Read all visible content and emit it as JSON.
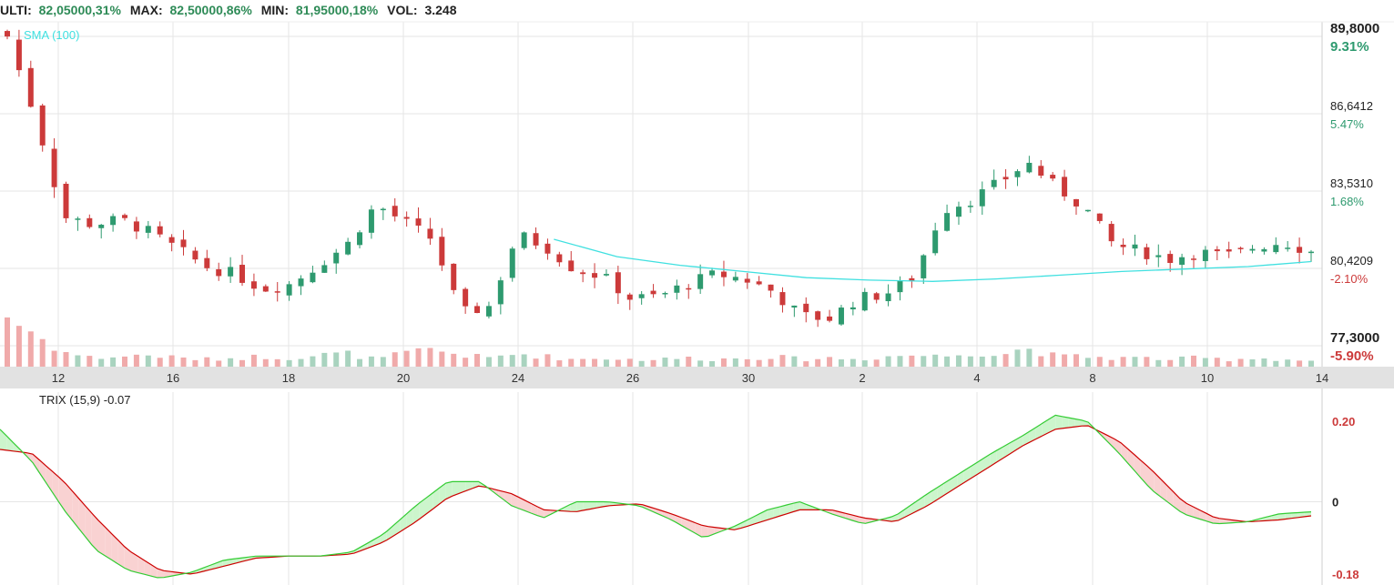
{
  "header": {
    "ulti_label": "ULTI:",
    "ulti_value": "82,05000,31%",
    "max_label": "MAX:",
    "max_value": "82,50000,86%",
    "min_label": "MIN:",
    "min_value": "81,95000,18%",
    "vol_label": "VOL:",
    "vol_value": "3.248"
  },
  "colors": {
    "up": "#2e9a6f",
    "down": "#cc3a3a",
    "sma": "#40e0e0",
    "trix": "#33cc33",
    "trix_signal": "#cc0000",
    "grid": "#e6e6e6",
    "axis_band": "#e2e2e2"
  },
  "chart_data": [
    {
      "type": "candlestick",
      "x_ticks": [
        "12",
        "16",
        "18",
        "20",
        "24",
        "26",
        "30",
        "2",
        "4",
        "8",
        "10",
        "14"
      ],
      "y_ticks": [
        {
          "price": "89,8000",
          "pct": "9.31%",
          "bold": true
        },
        {
          "price": "86,6412",
          "pct": "5.47%",
          "bold": false
        },
        {
          "price": "83,5310",
          "pct": "1.68%",
          "bold": false
        },
        {
          "price": "80,4209",
          "pct": "-2.10%",
          "bold": false
        },
        {
          "price": "77,3000",
          "pct": "-5.90%",
          "bold": true
        }
      ],
      "ylim": [
        77.3,
        89.8
      ],
      "indicator_label": "SMA (100)",
      "ohlc_anchor_closes": [
        89.8,
        86.5,
        82.5,
        82.2,
        82.4,
        81.9,
        81.2,
        80.5,
        80.2,
        79.6,
        79.8,
        80.6,
        81.4,
        83.0,
        82.3,
        81.6,
        78.6,
        78.9,
        81.8,
        81.3,
        80.4,
        80.1,
        79.2,
        79.3,
        79.8,
        80.2,
        80.0,
        79.5,
        78.5,
        78.4,
        79.2,
        79.4,
        80.1,
        82.8,
        83.2,
        83.9,
        84.7,
        83.7,
        82.9,
        81.4,
        81.1,
        80.8,
        81.1,
        80.9,
        81.3,
        81.5,
        81.1
      ],
      "volume_anchor": [
        3.5,
        2.2,
        1.0,
        0.6,
        0.7,
        0.8,
        0.6,
        0.5,
        0.6,
        0.7,
        0.6,
        0.8,
        0.9,
        0.5,
        0.9,
        1.2,
        0.8,
        0.6,
        0.9,
        0.7,
        0.5,
        0.6,
        0.5,
        0.5,
        0.6,
        0.5,
        0.6,
        0.7,
        0.5,
        0.6,
        0.5,
        0.7,
        0.8,
        0.7,
        1.0,
        0.8,
        1.3,
        0.7,
        0.7,
        0.6,
        0.6,
        0.5,
        0.6,
        0.5,
        0.6,
        0.5,
        0.4
      ],
      "sma_start_index": 18,
      "sma_points": [
        81.6,
        80.9,
        80.55,
        80.3,
        80.05,
        79.95,
        79.9,
        80.0,
        80.15,
        80.3,
        80.4,
        80.5,
        80.7
      ]
    },
    {
      "type": "line",
      "indicator_label": "TRIX (15,9) -0.07",
      "y_ticks": [
        "0.20",
        "0",
        "-0.18"
      ],
      "ylim": [
        -0.2,
        0.2
      ],
      "trix": [
        0.18,
        0.1,
        -0.02,
        -0.12,
        -0.17,
        -0.19,
        -0.175,
        -0.145,
        -0.135,
        -0.135,
        -0.135,
        -0.125,
        -0.08,
        -0.01,
        0.05,
        0.05,
        -0.01,
        -0.04,
        0.0,
        0.0,
        -0.01,
        -0.045,
        -0.09,
        -0.06,
        -0.02,
        0.0,
        -0.03,
        -0.055,
        -0.035,
        0.02,
        0.07,
        0.12,
        0.165,
        0.215,
        0.2,
        0.12,
        0.03,
        -0.03,
        -0.055,
        -0.05,
        -0.03,
        -0.025
      ],
      "signal": [
        0.13,
        0.12,
        0.05,
        -0.04,
        -0.12,
        -0.17,
        -0.18,
        -0.16,
        -0.14,
        -0.135,
        -0.135,
        -0.13,
        -0.1,
        -0.05,
        0.01,
        0.04,
        0.02,
        -0.02,
        -0.025,
        -0.01,
        -0.005,
        -0.03,
        -0.06,
        -0.07,
        -0.045,
        -0.02,
        -0.02,
        -0.04,
        -0.05,
        -0.01,
        0.04,
        0.09,
        0.14,
        0.18,
        0.19,
        0.15,
        0.08,
        0.0,
        -0.04,
        -0.05,
        -0.045,
        -0.035
      ]
    }
  ]
}
